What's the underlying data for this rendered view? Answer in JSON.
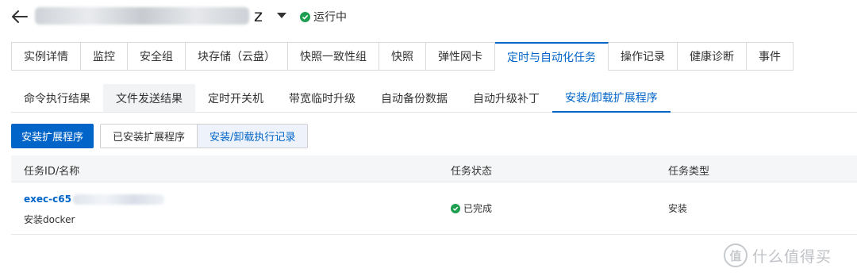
{
  "header": {
    "instance_name_suffix": "z",
    "status_label": "运行中"
  },
  "top_tabs": [
    {
      "label": "实例详情"
    },
    {
      "label": "监控"
    },
    {
      "label": "安全组"
    },
    {
      "label": "块存储（云盘）"
    },
    {
      "label": "快照一致性组"
    },
    {
      "label": "快照"
    },
    {
      "label": "弹性网卡"
    },
    {
      "label": "定时与自动化任务"
    },
    {
      "label": "操作记录"
    },
    {
      "label": "健康诊断"
    },
    {
      "label": "事件"
    }
  ],
  "sub_tabs": [
    {
      "label": "命令执行结果"
    },
    {
      "label": "文件发送结果"
    },
    {
      "label": "定时开关机"
    },
    {
      "label": "带宽临时升级"
    },
    {
      "label": "自动备份数据"
    },
    {
      "label": "自动升级补丁"
    },
    {
      "label": "安装/卸载扩展程序"
    }
  ],
  "actions": {
    "install_button": "安装扩展程序",
    "installed_button": "已安装扩展程序",
    "records_button": "安装/卸载执行记录"
  },
  "table": {
    "columns": [
      "任务ID/名称",
      "任务状态",
      "任务类型"
    ],
    "rows": [
      {
        "task_id_prefix": "exec-c65",
        "task_name": "安装docker",
        "status": "已完成",
        "type": "安装"
      }
    ]
  },
  "watermark": {
    "logo_char": "值",
    "text": "什么值得买"
  },
  "colors": {
    "accent": "#0064c8",
    "success": "#1e9e4f"
  }
}
